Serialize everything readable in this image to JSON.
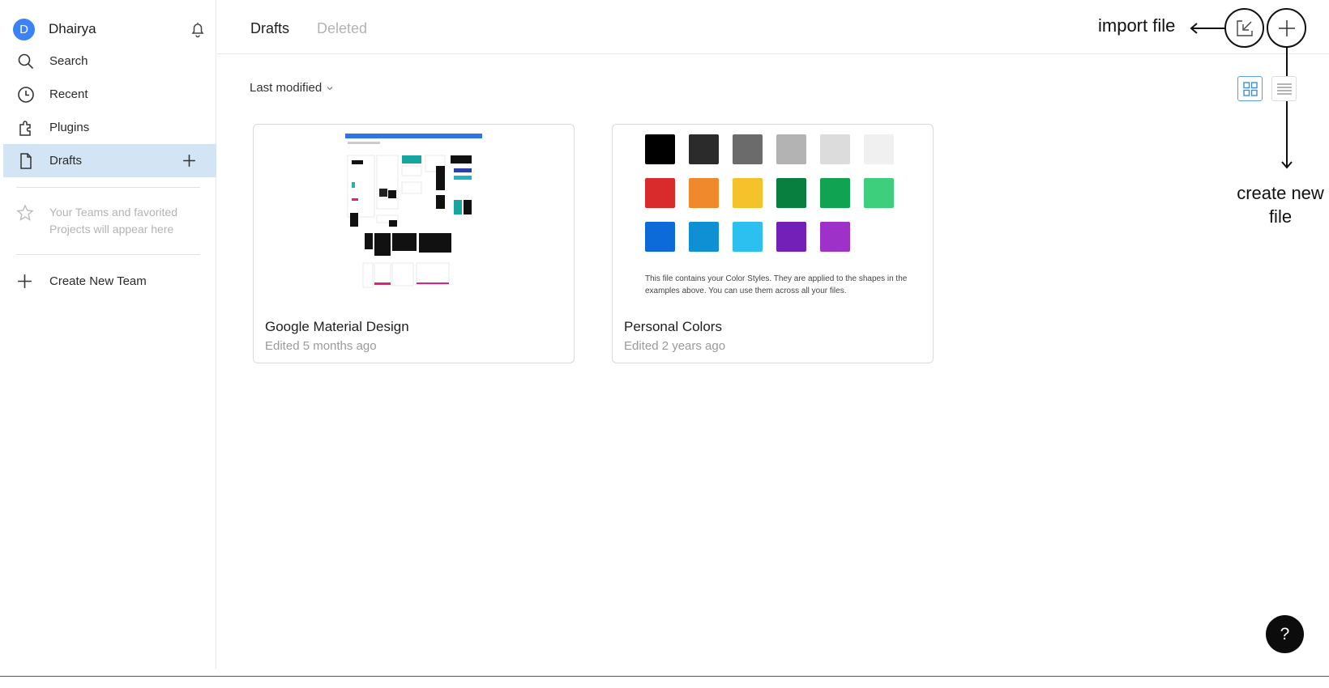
{
  "user": {
    "initial": "D",
    "name": "Dhairya"
  },
  "sidebar": {
    "items": [
      {
        "label": "Search",
        "icon": "search-icon"
      },
      {
        "label": "Recent",
        "icon": "clock-icon"
      },
      {
        "label": "Plugins",
        "icon": "plugin-icon"
      },
      {
        "label": "Drafts",
        "icon": "file-icon",
        "active": true
      }
    ],
    "favorites_note": "Your Teams and favorited Projects will appear here",
    "create_team_label": "Create New Team"
  },
  "header": {
    "tabs": [
      {
        "label": "Drafts",
        "active": true
      },
      {
        "label": "Deleted",
        "active": false
      }
    ]
  },
  "annotations": {
    "import_file": "import file",
    "create_new_file": "create new file"
  },
  "toolbar": {
    "sort_label": "Last modified",
    "view_mode": "grid"
  },
  "files": [
    {
      "title": "Google Material Design",
      "edited": "Edited 5 months ago"
    },
    {
      "title": "Personal Colors",
      "edited": "Edited 2 years ago",
      "note": "This file contains your Color Styles. They are applied to the shapes in the examples above. You can use them across all your files.",
      "swatches": [
        "#000000",
        "#2b2b2b",
        "#6b6b6b",
        "#b3b3b3",
        "#dcdcdc",
        "#f0f0f0",
        "#d92b2b",
        "#f0892b",
        "#f4c22b",
        "#087f3e",
        "#10a351",
        "#3ecf7c",
        "#0d6bd9",
        "#0f8fd4",
        "#2bc0ef",
        "#7320b8",
        "#9d31c8"
      ]
    }
  ],
  "help_label": "?",
  "colors": {
    "accent": "#3b82f6",
    "active_bg": "#d3e5f5"
  }
}
